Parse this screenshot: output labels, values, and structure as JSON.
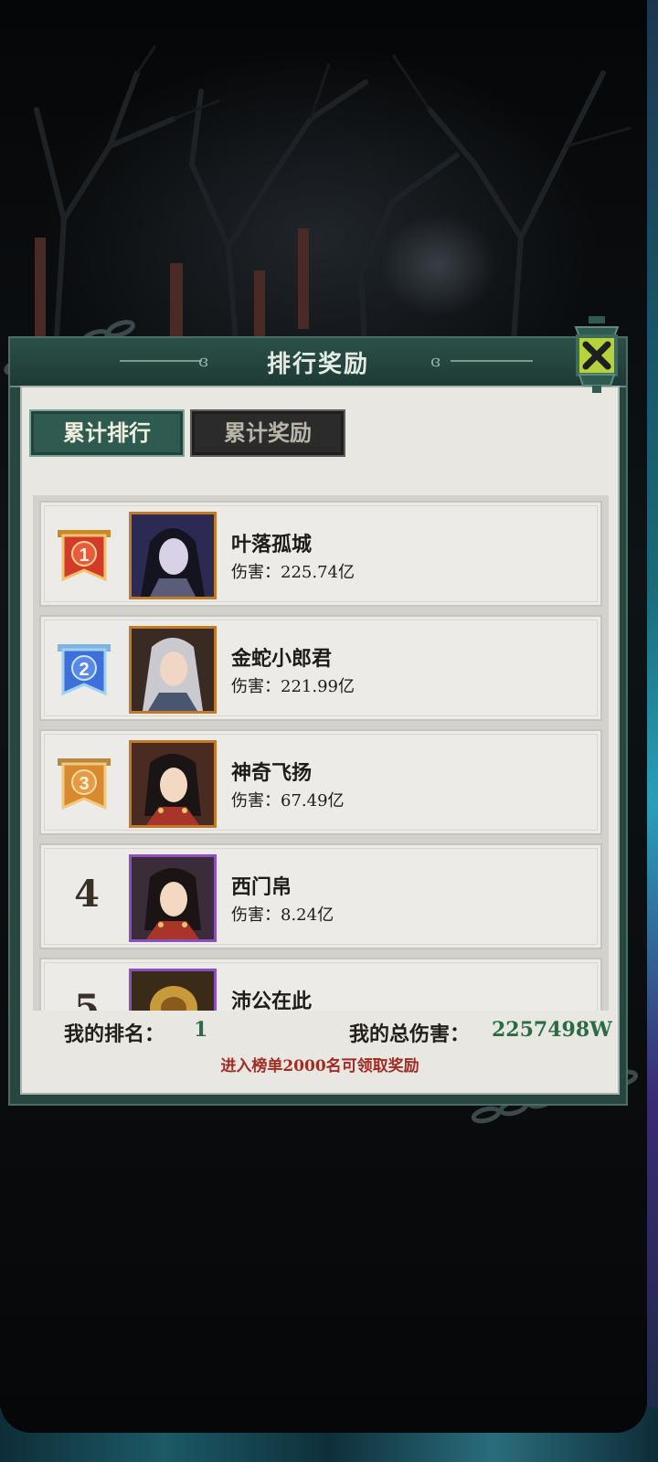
{
  "panel": {
    "title": "排行奖励",
    "tabs": [
      {
        "label": "累计排行",
        "active": true
      },
      {
        "label": "累计奖励",
        "active": false
      }
    ]
  },
  "ranking": [
    {
      "rank": "1",
      "name": "叶落孤城",
      "damage": "伤害：225.74亿",
      "medal_color": "#d23b2a",
      "frame": "gold"
    },
    {
      "rank": "2",
      "name": "金蛇小郎君",
      "damage": "伤害：221.99亿",
      "medal_color": "#3f6fd8",
      "frame": "gold"
    },
    {
      "rank": "3",
      "name": "神奇飞扬",
      "damage": "伤害：67.49亿",
      "medal_color": "#d9892f",
      "frame": "gold"
    },
    {
      "rank": "4",
      "name": "西门帛",
      "damage": "伤害：8.24亿",
      "frame": "purple"
    },
    {
      "rank": "5",
      "name": "沛公在此",
      "damage": "",
      "frame": "purple"
    }
  ],
  "footer": {
    "my_rank_label": "我的排名：",
    "my_rank_value": "1",
    "my_damage_label": "我的总伤害：",
    "my_damage_value": "2257498W",
    "hint": "进入榜单2000名可领取奖励"
  },
  "colors": {
    "panel_green": "#26463f",
    "value_green": "#2c6b46",
    "hint_red": "#a32b22"
  },
  "icons": {
    "close": "close-x-lantern-icon"
  }
}
